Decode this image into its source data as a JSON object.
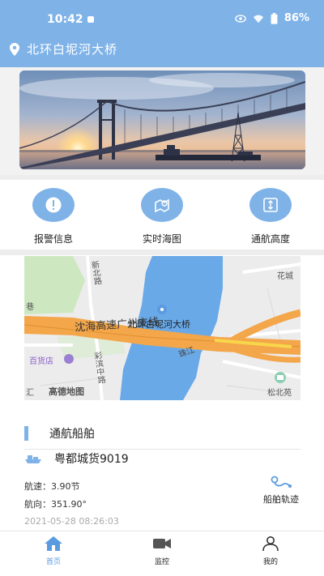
{
  "status_bar": {
    "time": "10:42",
    "battery": "86%"
  },
  "header": {
    "location": "北环白坭河大桥"
  },
  "quick_actions": [
    {
      "label": "报警信息",
      "icon": "alert-icon"
    },
    {
      "label": "实时海图",
      "icon": "chart-icon"
    },
    {
      "label": "通航高度",
      "icon": "height-icon"
    }
  ],
  "map": {
    "road_label": "沈海高速广州支线",
    "bridge_label": "北环白坭河大桥",
    "labels": {
      "huacheng": "花城",
      "songbeiyuan": "松北苑",
      "baihuodian": "百货店",
      "road_left": "新北路",
      "road_left2": "彩滨中路",
      "river": "珠江",
      "xiang": "巷",
      "hui": "汇"
    },
    "logo": "高德地图"
  },
  "section": {
    "title": "通航船舶"
  },
  "ship": {
    "name": "粤都城货9019",
    "speed": "航速：3.90节",
    "heading": "航向：351.90°",
    "timestamp": "2021-05-28 08:26:03",
    "track_label": "船舶轨迹"
  },
  "tabs": [
    {
      "label": "首页",
      "active": true
    },
    {
      "label": "监控",
      "active": false
    },
    {
      "label": "我的",
      "active": false
    }
  ],
  "colors": {
    "primary": "#7fb3e8",
    "active_tab": "#5a9be0"
  }
}
